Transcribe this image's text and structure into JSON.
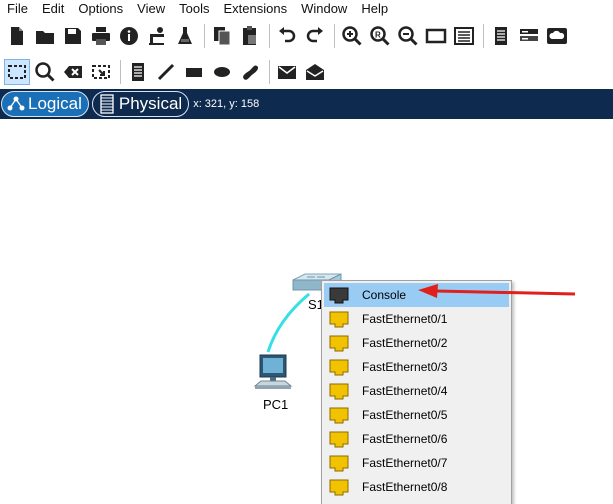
{
  "menubar": {
    "items": [
      "File",
      "Edit",
      "Options",
      "View",
      "Tools",
      "Extensions",
      "Window",
      "Help"
    ]
  },
  "toolbar_main": {
    "icons": [
      "new-file-icon",
      "open-folder-icon",
      "save-icon",
      "print-icon",
      "info-icon",
      "activity-wizard-icon",
      "lab-flask-icon",
      "copy-icon",
      "paste-icon",
      "undo-icon",
      "redo-icon",
      "zoom-in-icon",
      "zoom-reset-icon",
      "zoom-out-icon",
      "viewport-icon",
      "palette-icon",
      "notes-icon",
      "devices-icon",
      "cloud-icon"
    ]
  },
  "toolbar_tools": {
    "icons": [
      "select-icon",
      "inspect-icon",
      "delete-icon",
      "resize-icon",
      "note-icon",
      "draw-line-icon",
      "rectangle-icon",
      "ellipse-icon",
      "freeform-icon",
      "pdu-simple-icon",
      "pdu-complex-icon"
    ]
  },
  "modes": {
    "logical": "Logical",
    "physical": "Physical",
    "coords": "x: 321, y: 158"
  },
  "devices": {
    "switch_label": "S1",
    "pc_label": "PC1"
  },
  "colors": {
    "cable": "#33e0e6",
    "accent": "#1a6fb7",
    "selected_port": "#99ccf5",
    "port_yellow": "#f2c200",
    "arrow": "#e0201c"
  },
  "port_menu": {
    "items": [
      {
        "label": "Console",
        "type": "console"
      },
      {
        "label": "FastEthernet0/1",
        "type": "ethernet"
      },
      {
        "label": "FastEthernet0/2",
        "type": "ethernet"
      },
      {
        "label": "FastEthernet0/3",
        "type": "ethernet"
      },
      {
        "label": "FastEthernet0/4",
        "type": "ethernet"
      },
      {
        "label": "FastEthernet0/5",
        "type": "ethernet"
      },
      {
        "label": "FastEthernet0/6",
        "type": "ethernet"
      },
      {
        "label": "FastEthernet0/7",
        "type": "ethernet"
      },
      {
        "label": "FastEthernet0/8",
        "type": "ethernet"
      }
    ]
  }
}
